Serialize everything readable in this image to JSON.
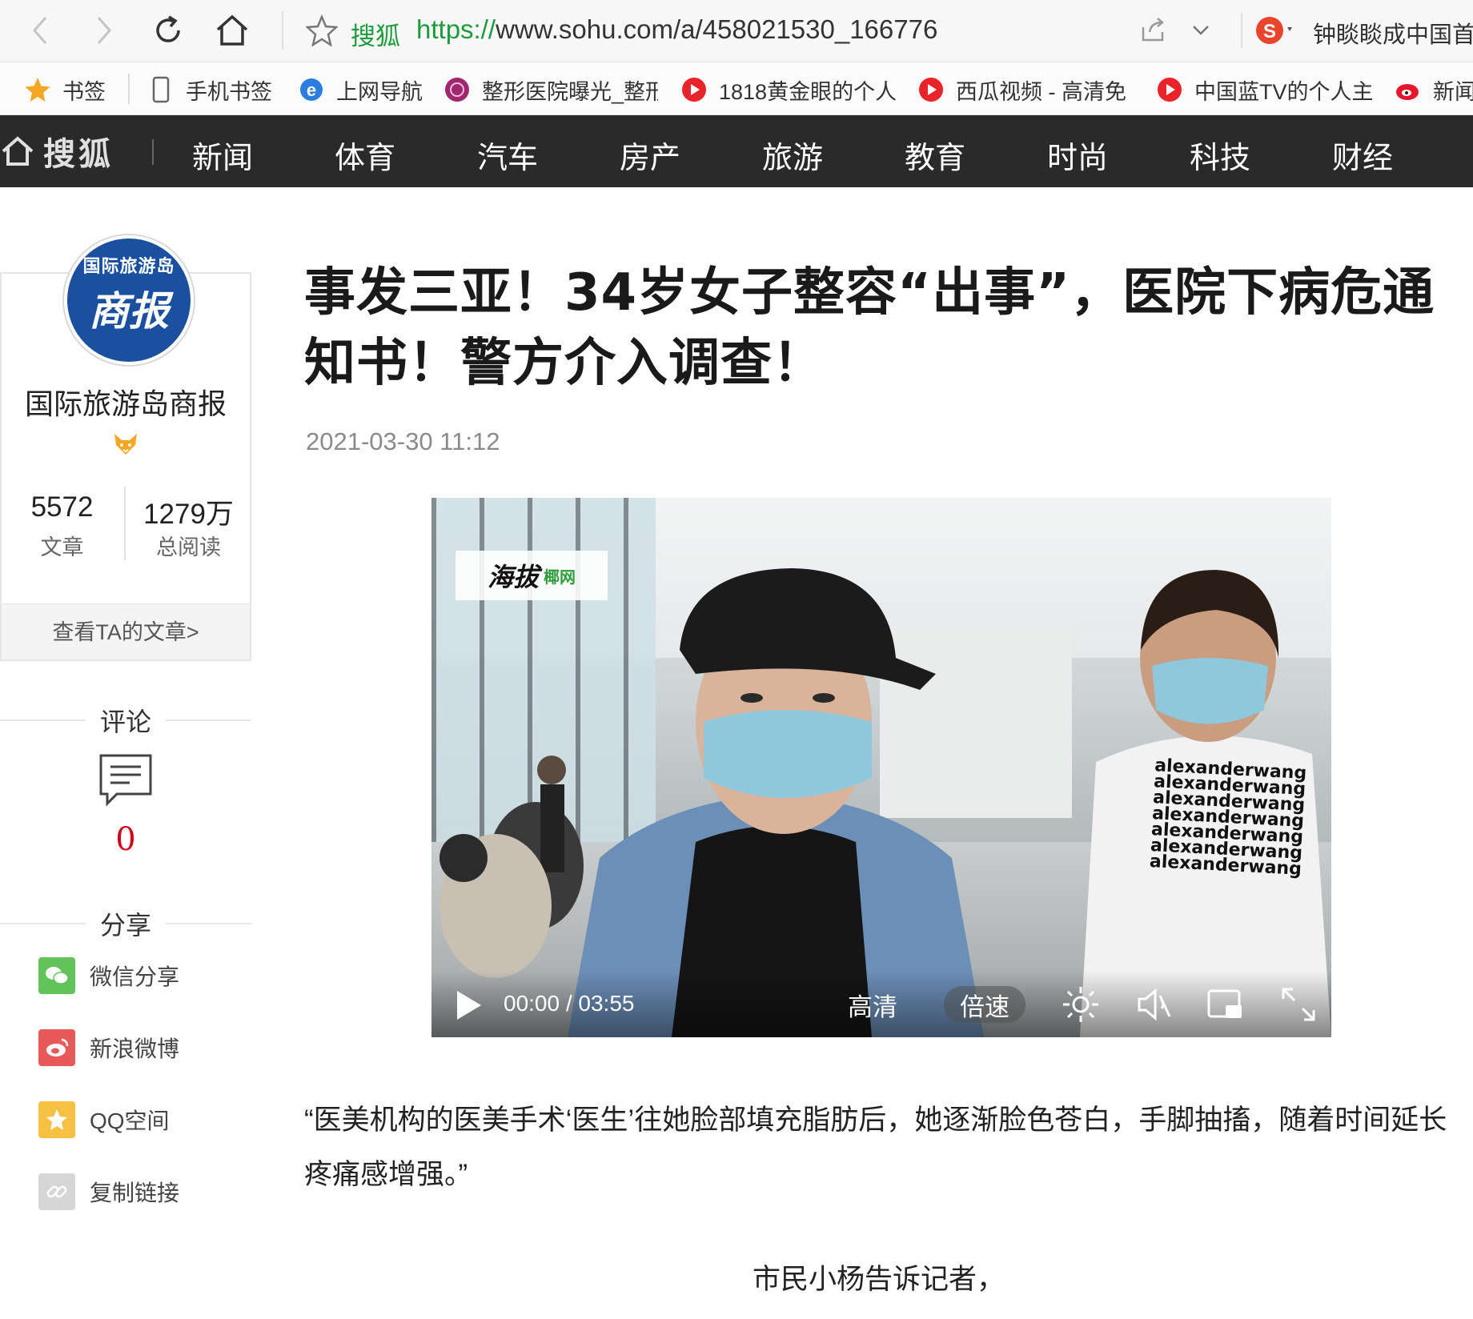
{
  "browser": {
    "site_name": "搜狐",
    "url_protocol": "https://",
    "url_rest": "www.sohu.com/a/458021530_166776",
    "search_text": "钟睒睒成中国首"
  },
  "bookmarks": [
    {
      "label": "书签",
      "icon": "star-icon"
    },
    {
      "label": "手机书签",
      "icon": "phone-icon"
    },
    {
      "label": "上网导航",
      "icon": "ie-icon"
    },
    {
      "label": "整形医院曝光_整形",
      "icon": "clinic-icon"
    },
    {
      "label": "1818黄金眼的个人主",
      "icon": "play-icon"
    },
    {
      "label": "西瓜视频 - 高清免",
      "icon": "play-icon"
    },
    {
      "label": "中国蓝TV的个人主",
      "icon": "play-icon"
    },
    {
      "label": "新闻",
      "icon": "weibo-icon"
    }
  ],
  "sohu_nav": {
    "logo": "搜狐",
    "items": [
      "新闻",
      "体育",
      "汽车",
      "房产",
      "旅游",
      "教育",
      "时尚",
      "科技",
      "财经"
    ]
  },
  "profile": {
    "avatar_top": "国际旅游岛",
    "avatar_bottom": "商报",
    "name": "国际旅游岛商报",
    "articles_count": "5572",
    "articles_label": "文章",
    "reads_count": "1279万",
    "reads_label": "总阅读",
    "view_link": "查看TA的文章>"
  },
  "comments": {
    "heading": "评论",
    "count": "0"
  },
  "share": {
    "heading": "分享",
    "items": [
      {
        "label": "微信分享",
        "icon": "wechat-icon",
        "color": "#62c35a"
      },
      {
        "label": "新浪微博",
        "icon": "weibo-icon",
        "color": "#e85a5a"
      },
      {
        "label": "QQ空间",
        "icon": "qzone-icon",
        "color": "#f6c142"
      },
      {
        "label": "复制链接",
        "icon": "link-icon",
        "color": "#d6d6d6"
      }
    ]
  },
  "article": {
    "title": "事发三亚！34岁女子整容“出事”，医院下病危通知书！警方介入调查！",
    "date": "2021-03-30 11:12",
    "paragraph1": "“医美机构的医美手术‘医生’往她脸部填充脂肪后，她逐渐脸色苍白，手脚抽搐，随着时间延长疼痛感增强。”",
    "paragraph2": "市民小杨告诉记者，"
  },
  "video": {
    "watermark": "海拔",
    "watermark_sub": "椰网",
    "shirt_text": "alexanderwang alexanderwang alexanderwang alexanderwang alexanderwang alexanderwang alexanderwang",
    "time": "00:00 / 03:55",
    "quality": "高清",
    "speed": "倍速"
  },
  "colors": {
    "nav_bg": "#2a2a2a",
    "url_green": "#1c9b3c",
    "comment_red": "#d0021b"
  }
}
